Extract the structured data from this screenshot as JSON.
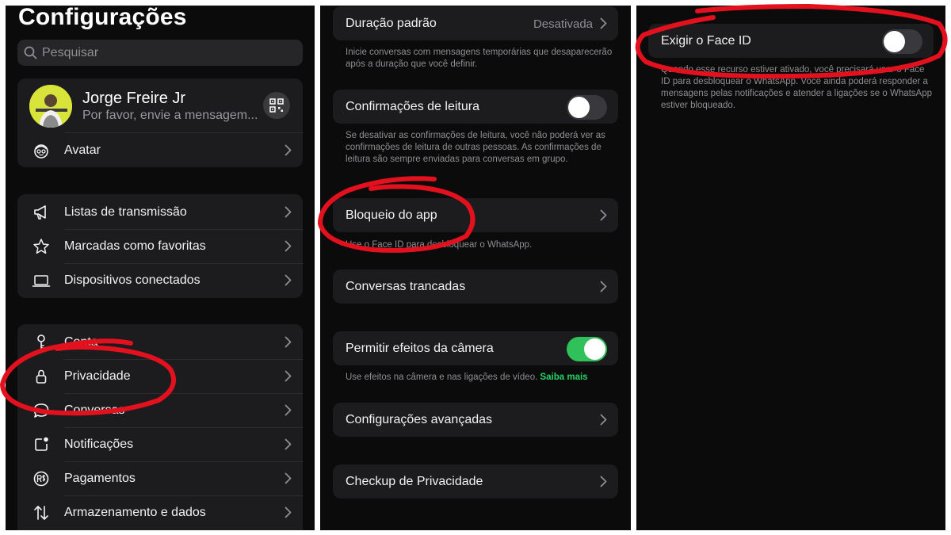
{
  "settings": {
    "title": "Configurações",
    "search_placeholder": "Pesquisar",
    "profile": {
      "name": "Jorge Freire Jr",
      "status": "Por favor, envie a mensagem..."
    },
    "avatar_row": "Avatar",
    "group1": [
      {
        "label": "Listas de transmissão",
        "icon": "megaphone-icon"
      },
      {
        "label": "Marcadas como favoritas",
        "icon": "star-icon"
      },
      {
        "label": "Dispositivos conectados",
        "icon": "laptop-icon"
      }
    ],
    "group2": [
      {
        "label": "Conta",
        "icon": "key-icon"
      },
      {
        "label": "Privacidade",
        "icon": "lock-icon"
      },
      {
        "label": "Conversas",
        "icon": "chat-bubble-icon"
      },
      {
        "label": "Notificações",
        "icon": "notification-badge-icon"
      },
      {
        "label": "Pagamentos",
        "icon": "real-currency-icon"
      },
      {
        "label": "Armazenamento e dados",
        "icon": "up-down-arrows-icon"
      }
    ]
  },
  "privacy": {
    "default_duration": {
      "label": "Duração padrão",
      "value": "Desativada"
    },
    "default_duration_note": "Inicie conversas com mensagens temporárias que desaparecerão após a duração que você definir.",
    "read_receipts": {
      "label": "Confirmações de leitura",
      "on": false
    },
    "read_receipts_note": "Se desativar as confirmações de leitura, você não poderá ver as confirmações de leitura de outras pessoas. As confirmações de leitura são sempre enviadas para conversas em grupo.",
    "app_lock": "Bloqueio do app",
    "app_lock_note": "Use o Face ID para desbloquear o WhatsApp.",
    "locked_chats": "Conversas trancadas",
    "camera_effects": {
      "label": "Permitir efeitos da câmera",
      "on": true
    },
    "camera_effects_note": "Use efeitos na câmera e nas ligações de vídeo.",
    "camera_effects_link": "Saiba mais",
    "advanced": "Configurações avançadas",
    "checkup": "Checkup de Privacidade"
  },
  "app_lock_screen": {
    "face_id": {
      "label": "Exigir o Face ID",
      "on": false
    },
    "note": "Quando esse recurso estiver ativado, você precisará usar o Face ID para desbloquear o WhatsApp. Você ainda poderá responder a mensagens pelas notificações e atender a ligações se o WhatsApp estiver bloqueado."
  },
  "colors": {
    "annotation": "#e3101e",
    "toggle_on": "#30c15b",
    "link": "#25d366"
  }
}
